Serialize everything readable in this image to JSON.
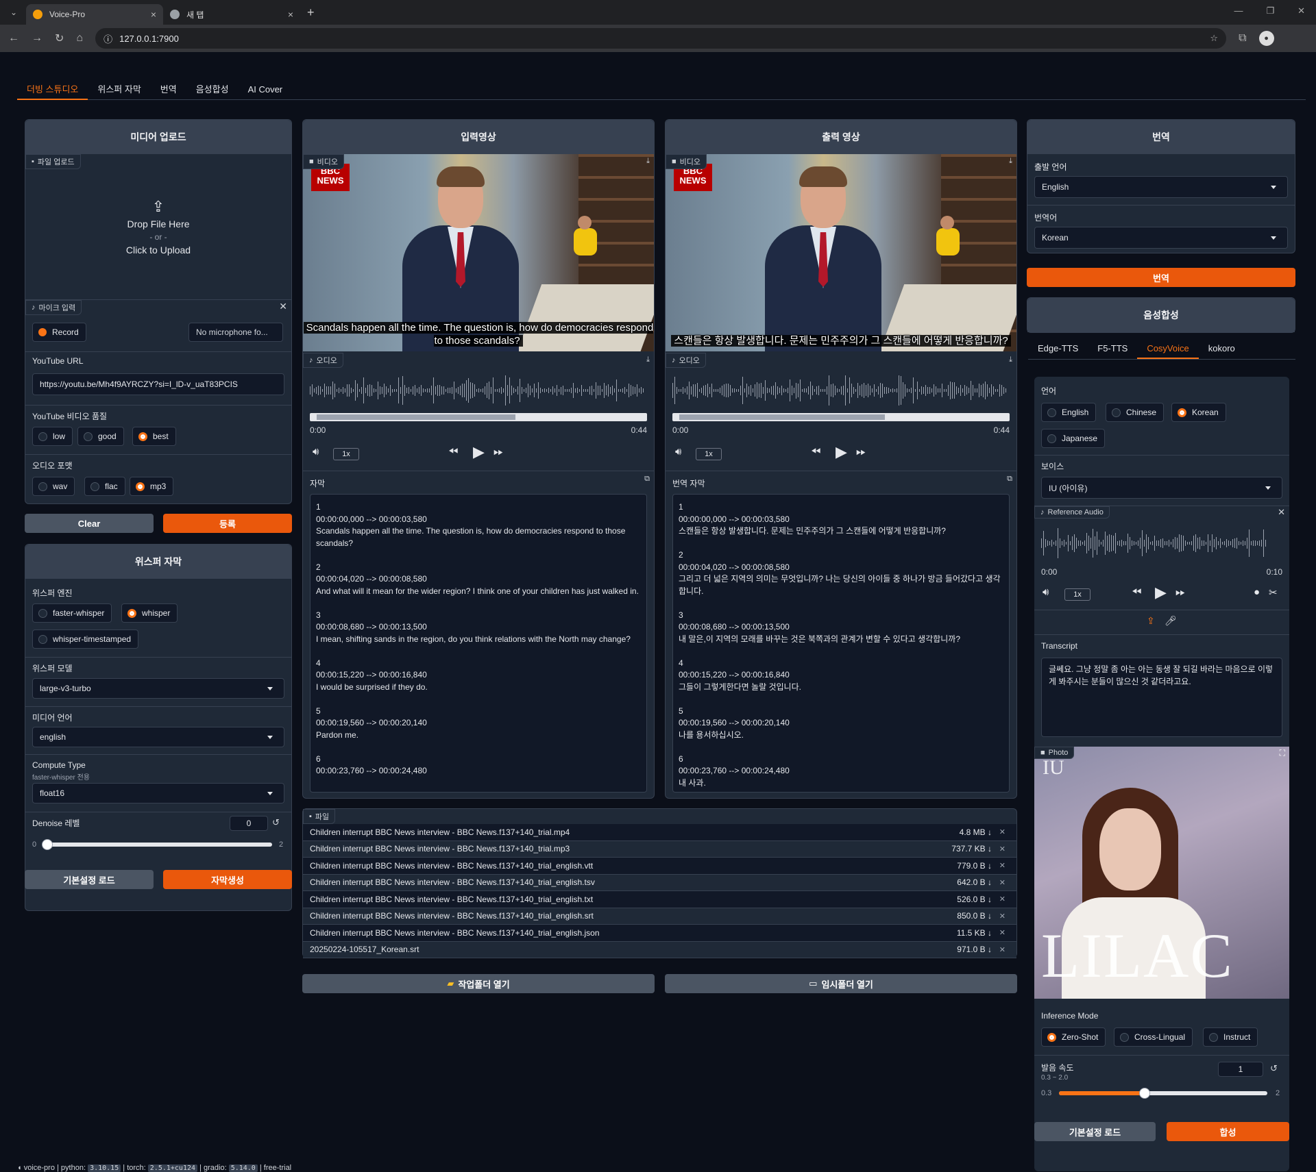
{
  "browser": {
    "tabs": [
      {
        "title": "Voice-Pro"
      },
      {
        "title": "새 탭"
      }
    ],
    "url": "127.0.0.1:7900"
  },
  "main_tabs": [
    "더빙 스튜디오",
    "위스퍼 자막",
    "번역",
    "음성합성",
    "AI Cover"
  ],
  "upload": {
    "title": "미디어 업로드",
    "file_badge": "파일 업로드",
    "drop": "Drop File Here",
    "or": "- or -",
    "click": "Click to Upload",
    "mic_badge": "마이크 입력",
    "record": "Record",
    "no_mic": "No microphone fo...",
    "youtube_label": "YouTube URL",
    "youtube_value": "https://youtu.be/Mh4f9AYRCZY?si=I_lD-v_uaT83PCIS",
    "quality_label": "YouTube 비디오 품질",
    "quality_options": [
      "low",
      "good",
      "best"
    ],
    "format_label": "오디오 포맷",
    "format_options": [
      "wav",
      "flac",
      "mp3"
    ],
    "clear": "Clear",
    "register": "등록"
  },
  "whisper": {
    "title": "위스퍼 자막",
    "engine_label": "위스퍼 엔진",
    "engines": [
      "faster-whisper",
      "whisper",
      "whisper-timestamped"
    ],
    "model_label": "위스퍼 모델",
    "model": "large-v3-turbo",
    "lang_label": "미디어 언어",
    "lang": "english",
    "compute_label": "Compute Type",
    "compute_sub": "faster-whisper 전용",
    "compute": "float16",
    "denoise_label": "Denoise 레벨",
    "denoise_value": "0",
    "denoise_min": "0",
    "denoise_max": "2",
    "load_defaults": "기본설정 로드",
    "generate": "자막생성"
  },
  "input_video": {
    "title": "입력영상",
    "video_badge": "비디오",
    "bbc": "BBC",
    "news": "NEWS",
    "caption": "Scandals happen all the time. The question is, how do democracies respond to those scandals?",
    "audio_badge": "오디오",
    "t_start": "0:00",
    "t_end": "0:44",
    "speed": "1x",
    "subs_label": "자막",
    "subs": "1\n00:00:00,000 --> 00:00:03,580\nScandals happen all the time. The question is, how do democracies respond to those scandals?\n\n2\n00:00:04,020 --> 00:00:08,580\nAnd what will it mean for the wider region? I think one of your children has just walked in.\n\n3\n00:00:08,680 --> 00:00:13,500\nI mean, shifting sands in the region, do you think relations with the North may change?\n\n4\n00:00:15,220 --> 00:00:16,840\nI would be surprised if they do.\n\n5\n00:00:19,560 --> 00:00:20,140\nPardon me.\n\n6\n00:00:23,760 --> 00:00:24,480"
  },
  "output_video": {
    "title": "출력 영상",
    "video_badge": "비디오",
    "caption": "스캔들은 항상 발생합니다. 문제는 민주주의가 그 스캔들에 어떻게 반응합니까?",
    "audio_badge": "오디오",
    "t_start": "0:00",
    "t_end": "0:44",
    "speed": "1x",
    "subs_label": "번역 자막",
    "subs": "1\n00:00:00,000 --> 00:00:03,580\n스캔들은 항상 발생합니다. 문제는 민주주의가 그 스캔들에 어떻게 반응합니까?\n\n2\n00:00:04,020 --> 00:00:08,580\n그리고 더 넓은 지역의 의미는 무엇입니까? 나는 당신의 아이들 중 하나가 방금 들어갔다고 생각합니다.\n\n3\n00:00:08,680 --> 00:00:13,500\n내 말은,이 지역의 모래를 바꾸는 것은 북쪽과의 관계가 변할 수 있다고 생각합니까?\n\n4\n00:00:15,220 --> 00:00:16,840\n그들이 그렇게한다면 놀랄 것입니다.\n\n5\n00:00:19,560 --> 00:00:20,140\n나를 용서하십시오.\n\n6\n00:00:23,760 --> 00:00:24,480\n내 사과."
  },
  "files": {
    "badge": "파일",
    "items": [
      {
        "name": "Children interrupt BBC News interview - BBC News.f137+140_trial.mp4",
        "size": "4.8 MB ↓"
      },
      {
        "name": "Children interrupt BBC News interview - BBC News.f137+140_trial.mp3",
        "size": "737.7 KB ↓"
      },
      {
        "name": "Children interrupt BBC News interview - BBC News.f137+140_trial_english.vtt",
        "size": "779.0 B ↓"
      },
      {
        "name": "Children interrupt BBC News interview - BBC News.f137+140_trial_english.tsv",
        "size": "642.0 B ↓"
      },
      {
        "name": "Children interrupt BBC News interview - BBC News.f137+140_trial_english.txt",
        "size": "526.0 B ↓"
      },
      {
        "name": "Children interrupt BBC News interview - BBC News.f137+140_trial_english.srt",
        "size": "850.0 B ↓"
      },
      {
        "name": "Children interrupt BBC News interview - BBC News.f137+140_trial_english.json",
        "size": "11.5 KB ↓"
      },
      {
        "name": "20250224-105517_Korean.srt",
        "size": "971.0 B ↓"
      }
    ],
    "open_work": "작업폴더 열기",
    "open_temp": "임시폴더 열기"
  },
  "translate": {
    "title": "번역",
    "src_label": "출발 언어",
    "src": "English",
    "tgt_label": "번역어",
    "tgt": "Korean",
    "button": "번역"
  },
  "tts": {
    "title": "음성합성",
    "tabs": [
      "Edge-TTS",
      "F5-TTS",
      "CosyVoice",
      "kokoro"
    ],
    "lang_label": "언어",
    "langs": [
      "English",
      "Chinese",
      "Korean",
      "Japanese"
    ],
    "voice_label": "보이스",
    "voice": "IU (아이유)",
    "ref_badge": "Reference Audio",
    "t_start": "0:00",
    "t_end": "0:10",
    "speed": "1x",
    "transcript_label": "Transcript",
    "transcript": "글쎄요. 그냥 정말 좀 아는 아는 동생 잘 되길 바라는 마음으로 이렇게 봐주시는 분들이 많으신 것 같더라고요.",
    "photo_badge": "Photo",
    "photo_iu": "IU",
    "photo_lilac": "LILAC",
    "mode_label": "Inference Mode",
    "modes": [
      "Zero-Shot",
      "Cross-Lingual",
      "Instruct"
    ],
    "rate_label": "발음 속도",
    "rate_sub": "0.3 ~ 2.0",
    "rate_value": "1",
    "rate_min": "0.3",
    "rate_max": "2",
    "rate_fraction": 0.41,
    "load_defaults": "기본설정 로드",
    "synth": "합성"
  },
  "status": {
    "prefix": "voice-pro | python: ",
    "python": "3.10.15",
    "torch_l": " | torch: ",
    "torch": "2.5.1+cu124",
    "gradio_l": " | gradio: ",
    "gradio": "5.14.0",
    "suffix": " | free-trial"
  }
}
